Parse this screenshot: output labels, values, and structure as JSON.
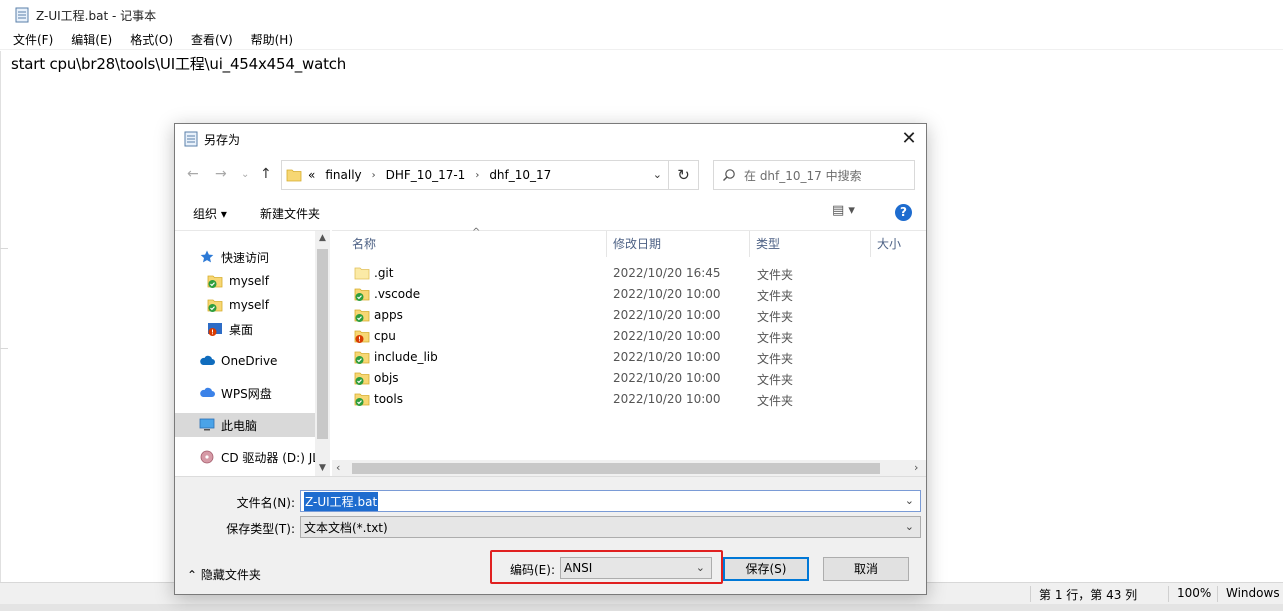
{
  "notepad": {
    "title": "Z-UI工程.bat - 记事本",
    "menu": [
      "文件(F)",
      "编辑(E)",
      "格式(O)",
      "查看(V)",
      "帮助(H)"
    ],
    "content_line": "start cpu\\br28\\tools\\UI工程\\ui_454x454_watch",
    "status": {
      "position": "第 1 行，第 43 列",
      "zoom": "100%",
      "line_ending": "Windows"
    }
  },
  "dialog": {
    "title": "另存为",
    "close_label": "✕",
    "breadcrumb": {
      "overflow": "«",
      "items": [
        "finally",
        "DHF_10_17-1",
        "dhf_10_17"
      ]
    },
    "search_placeholder": "在 dhf_10_17 中搜索",
    "toolbar": {
      "organize": "组织 ▾",
      "new_folder": "新建文件夹",
      "help": "?"
    },
    "nav_items": [
      {
        "label": "快速访问",
        "icon": "star-icon"
      },
      {
        "label": "myself",
        "icon": "synced-folder-icon"
      },
      {
        "label": "myself",
        "icon": "synced-folder-icon"
      },
      {
        "label": "桌面",
        "icon": "desktop-folder-icon"
      },
      {
        "label": "OneDrive",
        "icon": "cloud-icon"
      },
      {
        "label": "WPS网盘",
        "icon": "cloud-icon"
      },
      {
        "label": "此电脑",
        "icon": "computer-icon"
      },
      {
        "label": "CD 驱动器 (D:) JL",
        "icon": "cd-drive-icon"
      }
    ],
    "columns": {
      "name": "名称",
      "modified": "修改日期",
      "type": "类型",
      "size": "大小"
    },
    "files": [
      {
        "name": ".git",
        "modified": "2022/10/20 16:45",
        "type": "文件夹",
        "status": "plain"
      },
      {
        "name": ".vscode",
        "modified": "2022/10/20 10:00",
        "type": "文件夹",
        "status": "synced"
      },
      {
        "name": "apps",
        "modified": "2022/10/20 10:00",
        "type": "文件夹",
        "status": "synced"
      },
      {
        "name": "cpu",
        "modified": "2022/10/20 10:00",
        "type": "文件夹",
        "status": "error"
      },
      {
        "name": "include_lib",
        "modified": "2022/10/20 10:00",
        "type": "文件夹",
        "status": "synced"
      },
      {
        "name": "objs",
        "modified": "2022/10/20 10:00",
        "type": "文件夹",
        "status": "synced"
      },
      {
        "name": "tools",
        "modified": "2022/10/20 10:00",
        "type": "文件夹",
        "status": "synced"
      }
    ],
    "form": {
      "filename_label": "文件名(N):",
      "filename_value": "Z-UI工程.bat",
      "filetype_label": "保存类型(T):",
      "filetype_value": "文本文档(*.txt)",
      "encoding_label": "编码(E):",
      "encoding_value": "ANSI",
      "hide_folders": "隐藏文件夹",
      "save_button": "保存(S)",
      "cancel_button": "取消"
    },
    "colors": {
      "highlight_box": "#e02020",
      "selection": "#1e6ccf",
      "synced_badge": "#2e9e3e",
      "error_badge": "#d83b01",
      "folder": "#f7d774"
    }
  }
}
